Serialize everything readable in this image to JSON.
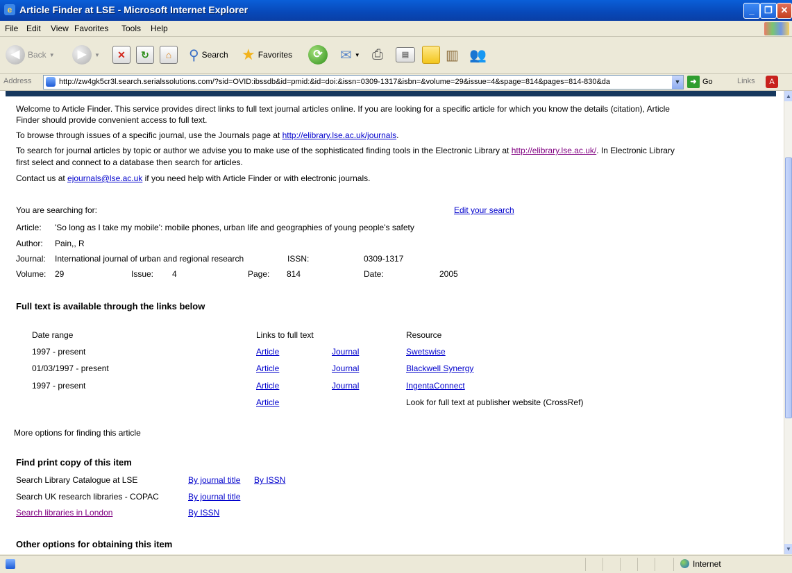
{
  "window": {
    "title": "Article Finder at LSE - Microsoft Internet Explorer"
  },
  "menu": [
    "File",
    "Edit",
    "View",
    "Favorites",
    "Tools",
    "Help"
  ],
  "toolbar": {
    "back_label": "Back",
    "search_label": "Search",
    "favorites_label": "Favorites"
  },
  "address": {
    "label": "Address",
    "url": "http://zw4gk5cr3l.search.serialssolutions.com/?sid=OVID:ibssdb&id=pmid:&id=doi:&issn=0309-1317&isbn=&volume=29&issue=4&spage=814&pages=814-830&da",
    "go_label": "Go",
    "links_label": "Links"
  },
  "intro": {
    "p1_line1": "Welcome to Article Finder. This service provides direct links to full text journal articles online. If you are looking for a specific article for which you know the details (citation), Article",
    "p1_line2": "Finder should provide convenient access to full text.",
    "p2_text": "To browse through issues of a specific journal, use the Journals page at ",
    "p2_link": "http://elibrary.lse.ac.uk/journals",
    "p2_end": ".",
    "p3_text": "To search for journal articles by topic or author we advise you to make use of the sophisticated finding tools in the Electronic Library at ",
    "p3_link": "http://elibrary.lse.ac.uk/",
    "p3_end": ". In Electronic Library",
    "p3_line2": "first select and connect to a database then search for articles.",
    "p4_text": "Contact us at ",
    "p4_link": "ejournals@lse.ac.uk",
    "p4_end": " if you need help with Article Finder or with electronic journals."
  },
  "search": {
    "heading": "You are searching for:",
    "edit_link": "Edit your search",
    "article_label": "Article:",
    "article_value": "'So long as I take my mobile': mobile phones, urban life and geographies of young people's safety",
    "author_label": "Author:",
    "author_value": "Pain,, R",
    "journal_label": "Journal:",
    "journal_value": "International journal of urban and regional research",
    "issn_label": "ISSN:",
    "issn_value": "0309-1317",
    "volume_label": "Volume:",
    "volume_value": "29",
    "issue_label": "Issue:",
    "issue_value": "4",
    "page_label": "Page:",
    "page_value": "814",
    "date_label": "Date:",
    "date_value": "2005"
  },
  "fulltext": {
    "heading": "Full text is available through the links below",
    "col_date": "Date range",
    "col_links": "Links to full text",
    "col_resource": "Resource",
    "rows": [
      {
        "date": "1997 - present",
        "article": "Article",
        "journal": "Journal",
        "resource": "Swetswise"
      },
      {
        "date": "01/03/1997 - present",
        "article": "Article",
        "journal": "Journal",
        "resource": "Blackwell Synergy"
      },
      {
        "date": "1997 - present",
        "article": "Article",
        "journal": "Journal",
        "resource": "IngentaConnect"
      },
      {
        "date": "",
        "article": "Article",
        "journal": "",
        "resource": "Look for full text at publisher website (CrossRef)"
      }
    ]
  },
  "more_options": "More options for finding this article",
  "print": {
    "heading": "Find print copy of this item",
    "row1_label": "Search Library Catalogue at LSE",
    "row1_link1": "By journal title",
    "row1_link2": "By ISSN",
    "row2_label": "Search UK research libraries - COPAC",
    "row2_link1": "By journal title",
    "row3_label": "Search libraries in London",
    "row3_link1": "By ISSN"
  },
  "other_heading": "Other options for obtaining this item",
  "status": {
    "zone": "Internet"
  }
}
